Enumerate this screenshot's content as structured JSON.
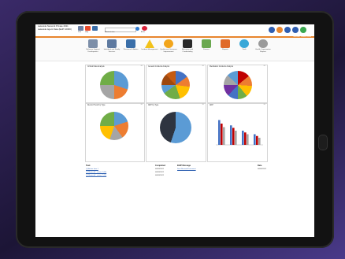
{
  "app": {
    "brand_line1": "Lakeside Network Private 2021",
    "brand_line2": "Lakeside Agent Data (EHP 1000K)",
    "toolbar": [
      "Print",
      "Help",
      "Administration",
      "Alerts"
    ],
    "welcome": "Welcome, Jennifer Evans"
  },
  "ribbon": [
    {
      "label": "Behavior Support Development",
      "icon": "people-icon",
      "color": "#7c8ea8"
    },
    {
      "label": "Individual and Family Services",
      "icon": "family-icon",
      "color": "#5f7aa0"
    },
    {
      "label": "Personnel & Admin",
      "icon": "admin-icon",
      "color": "#3a6ea8"
    },
    {
      "label": "Incident Management",
      "icon": "warning-icon",
      "color": "#f2c21b"
    },
    {
      "label": "Quality and Outcomes Improvement",
      "icon": "quality-icon",
      "color": "#f2a51b"
    },
    {
      "label": "Education and Credentialing",
      "icon": "education-icon",
      "color": "#2a2a2a"
    },
    {
      "label": "Finance",
      "icon": "finance-icon",
      "color": "#6aa84f"
    },
    {
      "label": "Reports",
      "icon": "reports-icon",
      "color": "#e06a2a"
    },
    {
      "label": "Tools",
      "icon": "tools-icon",
      "color": "#3aa8d8"
    },
    {
      "label": "Health Organization Reports",
      "icon": "health-icon",
      "color": "#9a9a9a"
    }
  ],
  "panels": [
    {
      "title": "Critical Data Analysis"
    },
    {
      "title": "General Incidents Analysis"
    },
    {
      "title": "Medication Incidents Analysis"
    },
    {
      "title": "Record Trend by Type"
    },
    {
      "title": "ADP by Type"
    },
    {
      "title": "ADP"
    }
  ],
  "chart_data": [
    {
      "type": "pie",
      "values": [
        30,
        20,
        25,
        25
      ],
      "colors": [
        "#5b9bd5",
        "#ed7d31",
        "#a5a5a5",
        "#70ad47"
      ]
    },
    {
      "type": "pie",
      "values": [
        15,
        12,
        18,
        20,
        10,
        13,
        12
      ],
      "colors": [
        "#4472c4",
        "#ed7d31",
        "#ffc000",
        "#70ad47",
        "#5b9bd5",
        "#9e480e",
        "#c55a11"
      ]
    },
    {
      "type": "pie",
      "values": [
        14,
        12,
        13,
        11,
        12,
        13,
        12,
        13
      ],
      "colors": [
        "#c00000",
        "#ed7d31",
        "#ffc000",
        "#70ad47",
        "#4472c4",
        "#7030a0",
        "#a5a5a5",
        "#5b9bd5"
      ]
    },
    {
      "type": "pie",
      "values": [
        20,
        20,
        15,
        20,
        25
      ],
      "colors": [
        "#5b9bd5",
        "#ed7d31",
        "#a5a5a5",
        "#ffc000",
        "#70ad47"
      ]
    },
    {
      "type": "pie",
      "values": [
        55,
        45
      ],
      "colors": [
        "#5b9bd5",
        "#2e3440"
      ]
    },
    {
      "type": "bar",
      "categories": [
        "",
        "",
        "",
        ""
      ],
      "series": [
        {
          "values": [
            70,
            55,
            40,
            30
          ]
        },
        {
          "values": [
            60,
            48,
            35,
            25
          ]
        },
        {
          "values": [
            50,
            40,
            30,
            20
          ]
        }
      ],
      "colors": [
        "#4472c4",
        "#c00000",
        "#a5a5a5"
      ],
      "ylim": [
        0,
        80
      ]
    }
  ],
  "table": {
    "headers": [
      "Task",
      "Completed",
      "EHIP Message",
      "Date"
    ],
    "rows": [
      [
        "(1) Action item 1",
        "06/09/2022",
        "Sent Revised Document",
        "06/09/2022"
      ],
      [
        "(1) Moncrieff - action 1 (ID)",
        "06/09/2022",
        "",
        ""
      ],
      [
        "(1) Moncrieff - action 2 (ID)",
        "06/09/2022",
        "",
        ""
      ]
    ]
  }
}
